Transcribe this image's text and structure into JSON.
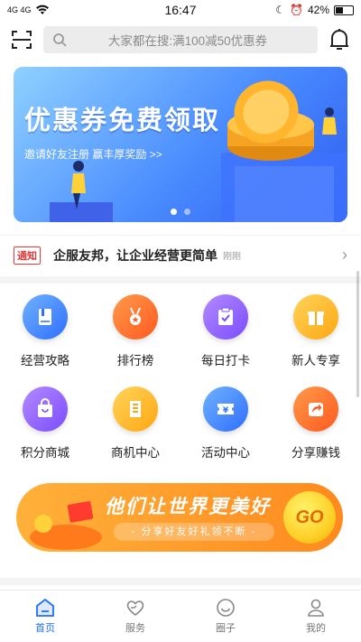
{
  "status_bar": {
    "network": "4G 4G",
    "time": "16:47",
    "battery": "42%"
  },
  "header": {
    "search_placeholder": "大家都在搜:满100减50优惠券"
  },
  "banner": {
    "title": "优惠券免费领取",
    "subtitle": "邀请好友注册  赢丰厚奖励 >>",
    "slide_count": 2,
    "active_slide": 1
  },
  "notice": {
    "tag": "通知",
    "text": "企服友邦，让企业经营更简单",
    "time": "刚刚"
  },
  "grid": {
    "items": [
      {
        "label": "经营攻略",
        "icon": "book-icon",
        "color": "#3b82ff"
      },
      {
        "label": "排行榜",
        "icon": "medal-icon",
        "color": "#ff6a2a"
      },
      {
        "label": "每日打卡",
        "icon": "checkin-icon",
        "color": "#8a5cff"
      },
      {
        "label": "新人专享",
        "icon": "gift-icon",
        "color": "#ffb21a"
      },
      {
        "label": "积分商城",
        "icon": "shopping-bag-icon",
        "color": "#8a5cff"
      },
      {
        "label": "商机中心",
        "icon": "building-icon",
        "color": "#ffb21a"
      },
      {
        "label": "活动中心",
        "icon": "ticket-icon",
        "color": "#3b82ff"
      },
      {
        "label": "分享赚钱",
        "icon": "share-icon",
        "color": "#ff6a2a"
      }
    ]
  },
  "promo": {
    "title": "他们让世界更美好",
    "subtitle": "- 分享好友好礼领不断 -",
    "go_label": "GO"
  },
  "tabbar": {
    "tabs": [
      {
        "label": "首页",
        "icon": "home-icon",
        "active": true
      },
      {
        "label": "服务",
        "icon": "heart-hand-icon",
        "active": false
      },
      {
        "label": "圈子",
        "icon": "circle-smile-icon",
        "active": false
      },
      {
        "label": "我的",
        "icon": "user-icon",
        "active": false
      }
    ]
  },
  "colors": {
    "accent": "#1e6fff",
    "notice_red": "#e4393c"
  }
}
